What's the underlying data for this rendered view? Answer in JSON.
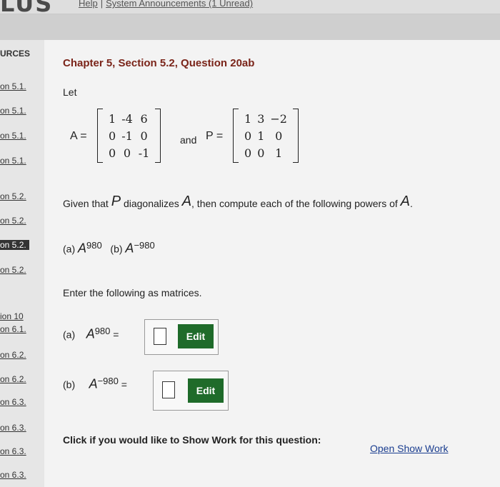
{
  "header": {
    "logo": "LUS",
    "help": "Help",
    "separator": "|",
    "announcements": "System Announcements (1 Unread)"
  },
  "sidebar": {
    "title": "URCES",
    "links": [
      "on 5.1.",
      "on 5.1.",
      "on 5.1.",
      "on 5.1.",
      "on 5.2.",
      "on 5.2.",
      "on 5.2.",
      "on 5.2.",
      "ion 10",
      "on 6.1.",
      "on 6.2.",
      "on 6.2.",
      "on 6.3.",
      "on 6.3.",
      "on 6.3.",
      "on 6.3."
    ]
  },
  "question": {
    "title": "Chapter 5, Section 5.2, Question 20ab",
    "let": "Let",
    "matrix_a_label": "A =",
    "matrix_a": [
      [
        "1",
        "-4",
        "6"
      ],
      [
        "0",
        "-1",
        "0"
      ],
      [
        "0",
        "0",
        "-1"
      ]
    ],
    "and": "and",
    "matrix_p_label": "P =",
    "matrix_p": [
      [
        "1",
        "3",
        "−2"
      ],
      [
        "0",
        "1",
        "0"
      ],
      [
        "0",
        "0",
        "1"
      ]
    ],
    "given_prefix": "Given that",
    "given_p": "P",
    "given_mid": "diagonalizes",
    "given_a": "A",
    "given_suffix": ", then compute each of the following powers of",
    "given_a2": "A",
    "given_end": ".",
    "part_a_label": "(a)",
    "part_b_label": "(b)",
    "sym_a": "A",
    "exp_pos": "980",
    "exp_neg": "−980",
    "enter": "Enter the following as matrices.",
    "equals": "=",
    "edit_label": "Edit",
    "show_work_text": "Click if you would like to Show Work for this question:",
    "show_work_link": "Open Show Work"
  }
}
